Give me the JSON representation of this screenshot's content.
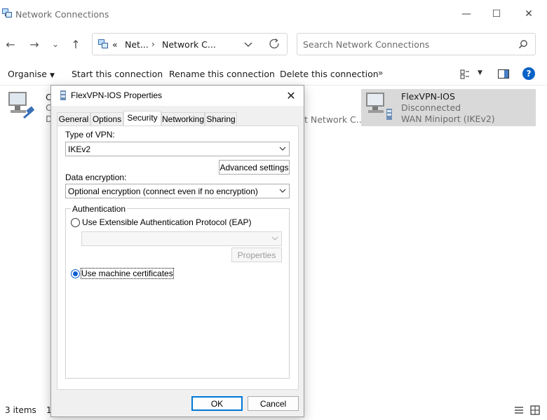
{
  "window": {
    "title": "Network Connections",
    "controls": {
      "minimize": "—",
      "maximize": "☐",
      "close": "✕"
    }
  },
  "nav": {
    "back": "←",
    "forward": "→",
    "recent": "⌄",
    "up": "↑",
    "overflow": "«",
    "breadcrumb": [
      "Net...",
      "Network C..."
    ],
    "separator": "›",
    "search_placeholder": "Search Network Connections"
  },
  "commandbar": {
    "organise": "Organise",
    "start": "Start this connection",
    "rename": "Rename this connection",
    "delete": "Delete this connection",
    "more": "»"
  },
  "items": {
    "left_fragments": {
      "c1": "C",
      "c2": "C",
      "d": "D"
    },
    "middle_fragment": "t Network C...",
    "flex": {
      "name": "FlexVPN-IOS",
      "status": "Disconnected",
      "device": "WAN Miniport (IKEv2)"
    }
  },
  "statusbar": {
    "count": "3 items",
    "fragment": "1"
  },
  "dialog": {
    "title": "FlexVPN-IOS Properties",
    "tabs": [
      "General",
      "Options",
      "Security",
      "Networking",
      "Sharing"
    ],
    "active_tab": "Security",
    "vpn_type_label": "Type of VPN:",
    "vpn_type_value": "IKEv2",
    "advanced_button": "Advanced settings",
    "encryption_label": "Data encryption:",
    "encryption_value": "Optional encryption (connect even if no encryption)",
    "auth_legend": "Authentication",
    "eap_radio": "Use Extensible Authentication Protocol (EAP)",
    "eap_properties": "Properties",
    "machine_cert_radio": "Use machine certificates",
    "ok": "OK",
    "cancel": "Cancel"
  },
  "colors": {
    "accent": "#0a63c7",
    "selected_item": "#d9d9d9",
    "radio_checked": "#0a5fd0"
  }
}
